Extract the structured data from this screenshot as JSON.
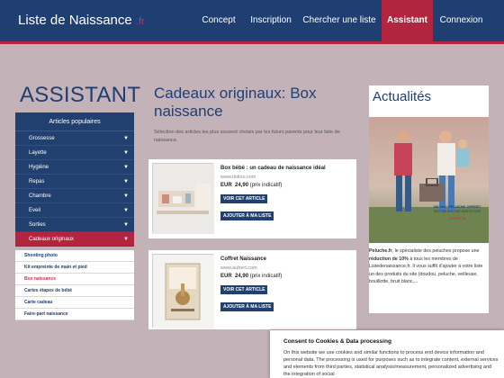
{
  "header": {
    "logo": "Liste de Naissance",
    "logo_suffix": ".fr",
    "nav": [
      "Concept",
      "Inscription",
      "Chercher une liste",
      "Assistant",
      "Connexion"
    ],
    "active_nav": "Assistant",
    "colors": {
      "navy": "#1f3f73",
      "red": "#b3243f"
    }
  },
  "sidebar": {
    "heading": "ASSISTANT",
    "menu_title": "Articles populaires",
    "items": [
      {
        "label": "Grossesse"
      },
      {
        "label": "Layette"
      },
      {
        "label": "Hygiène"
      },
      {
        "label": "Repas"
      },
      {
        "label": "Chambre"
      },
      {
        "label": "Eveil"
      },
      {
        "label": "Sorties"
      },
      {
        "label": "Cadeaux originaux"
      }
    ],
    "subitems": [
      {
        "label": "Shooting photo"
      },
      {
        "label": "Kit empreinte de main et pied"
      },
      {
        "label": "Box naissance"
      },
      {
        "label": "Cartes étapes de bébé"
      },
      {
        "label": "Carte cadeau"
      },
      {
        "label": "Faire-part naissance"
      }
    ]
  },
  "main": {
    "title": "Cadeaux originaux: Box naissance",
    "intro": "Sélection des articles les plus souvent choisis par les futurs parents pour leur liste de naissance.",
    "products": [
      {
        "name": "Box bébé : un cadeau de naissance idéal",
        "url": "www.tiniloo.com",
        "currency": "EUR",
        "price": "24,90",
        "price_note": "(prix indicatif)",
        "view_label": "VOIR CET ARTICLE",
        "add_label": "AJOUTER À MA LISTE"
      },
      {
        "name": "Coffret Naissance",
        "url": "www.aubert.com",
        "currency": "EUR",
        "price": "24,90",
        "price_note": "(prix indicatif)",
        "view_label": "VOIR CET ARTICLE",
        "add_label": "AJOUTER À MA LISTE"
      }
    ]
  },
  "news": {
    "title": "Actualités",
    "promo_line1": "UN SAC PELUCHE OFFERT",
    "promo_line2": "DES 39€ D'ACHAT SUR LE SITE",
    "promo_badge": "OFFERTE",
    "brand": "Peluche.fr",
    "text_before": ", le spécialiste des peluches propose une ",
    "text_bold": "réduction de 10%",
    "text_after": " à tous les membres de Listedenaissance.fr. Il vous suffit d'ajouter à votre liste un des produits du site (doudou, peluche, veilleuse, bouillotte, bruit blanc,..."
  },
  "cookie": {
    "title": "Consent to Cookies & Data processing",
    "text": "On this website we use cookies and similar functions to process end device information and personal data. The processing is used for purposes such as to integrate content, external services and elements from third parties, statistical analysis/measurement, personalized advertising and the integration of social"
  }
}
